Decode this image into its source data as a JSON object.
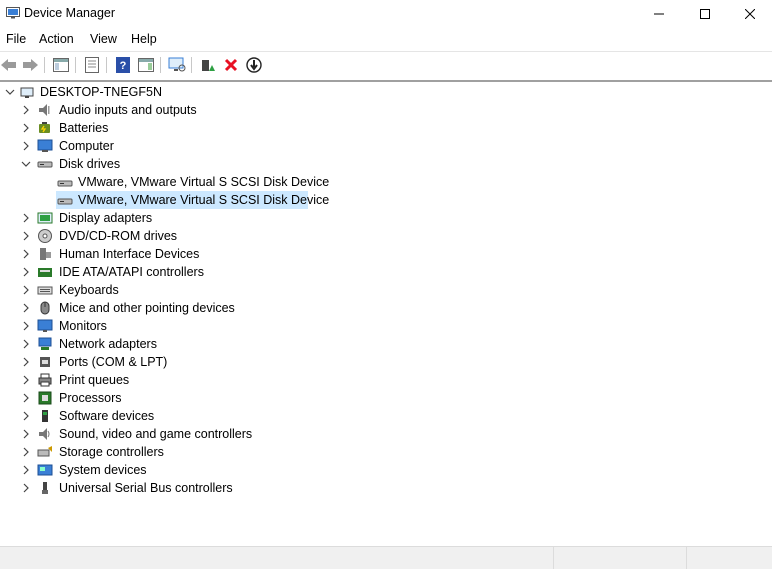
{
  "window": {
    "title": "Device Manager"
  },
  "menu": [
    "File",
    "Action",
    "View",
    "Help"
  ],
  "tree": {
    "root": "DESKTOP-TNEGF5N",
    "categories": [
      {
        "label": "Audio inputs and outputs",
        "icon": "speaker-icon"
      },
      {
        "label": "Batteries",
        "icon": "battery-icon"
      },
      {
        "label": "Computer",
        "icon": "computer-icon"
      },
      {
        "label": "Disk drives",
        "icon": "disk-drive-icon",
        "expanded": true,
        "children": [
          "VMware, VMware Virtual S SCSI Disk Device",
          "VMware, VMware Virtual S SCSI Disk Device"
        ]
      },
      {
        "label": "Display adapters",
        "icon": "display-adapter-icon"
      },
      {
        "label": "DVD/CD-ROM drives",
        "icon": "dvd-icon"
      },
      {
        "label": "Human Interface Devices",
        "icon": "hid-icon"
      },
      {
        "label": "IDE ATA/ATAPI controllers",
        "icon": "ide-icon"
      },
      {
        "label": "Keyboards",
        "icon": "keyboard-icon"
      },
      {
        "label": "Mice and other pointing devices",
        "icon": "mouse-icon"
      },
      {
        "label": "Monitors",
        "icon": "monitor-icon"
      },
      {
        "label": "Network adapters",
        "icon": "network-icon"
      },
      {
        "label": "Ports (COM & LPT)",
        "icon": "port-icon"
      },
      {
        "label": "Print queues",
        "icon": "printer-icon"
      },
      {
        "label": "Processors",
        "icon": "processor-icon"
      },
      {
        "label": "Software devices",
        "icon": "software-device-icon"
      },
      {
        "label": "Sound, video and game controllers",
        "icon": "sound-icon"
      },
      {
        "label": "Storage controllers",
        "icon": "storage-icon"
      },
      {
        "label": "System devices",
        "icon": "system-devices-icon"
      },
      {
        "label": "Universal Serial Bus controllers",
        "icon": "usb-icon"
      }
    ],
    "selected_child": 1
  },
  "colors": {
    "selection": "#cce8ff",
    "delete": "#e81123",
    "help": "#2a4fa8"
  }
}
